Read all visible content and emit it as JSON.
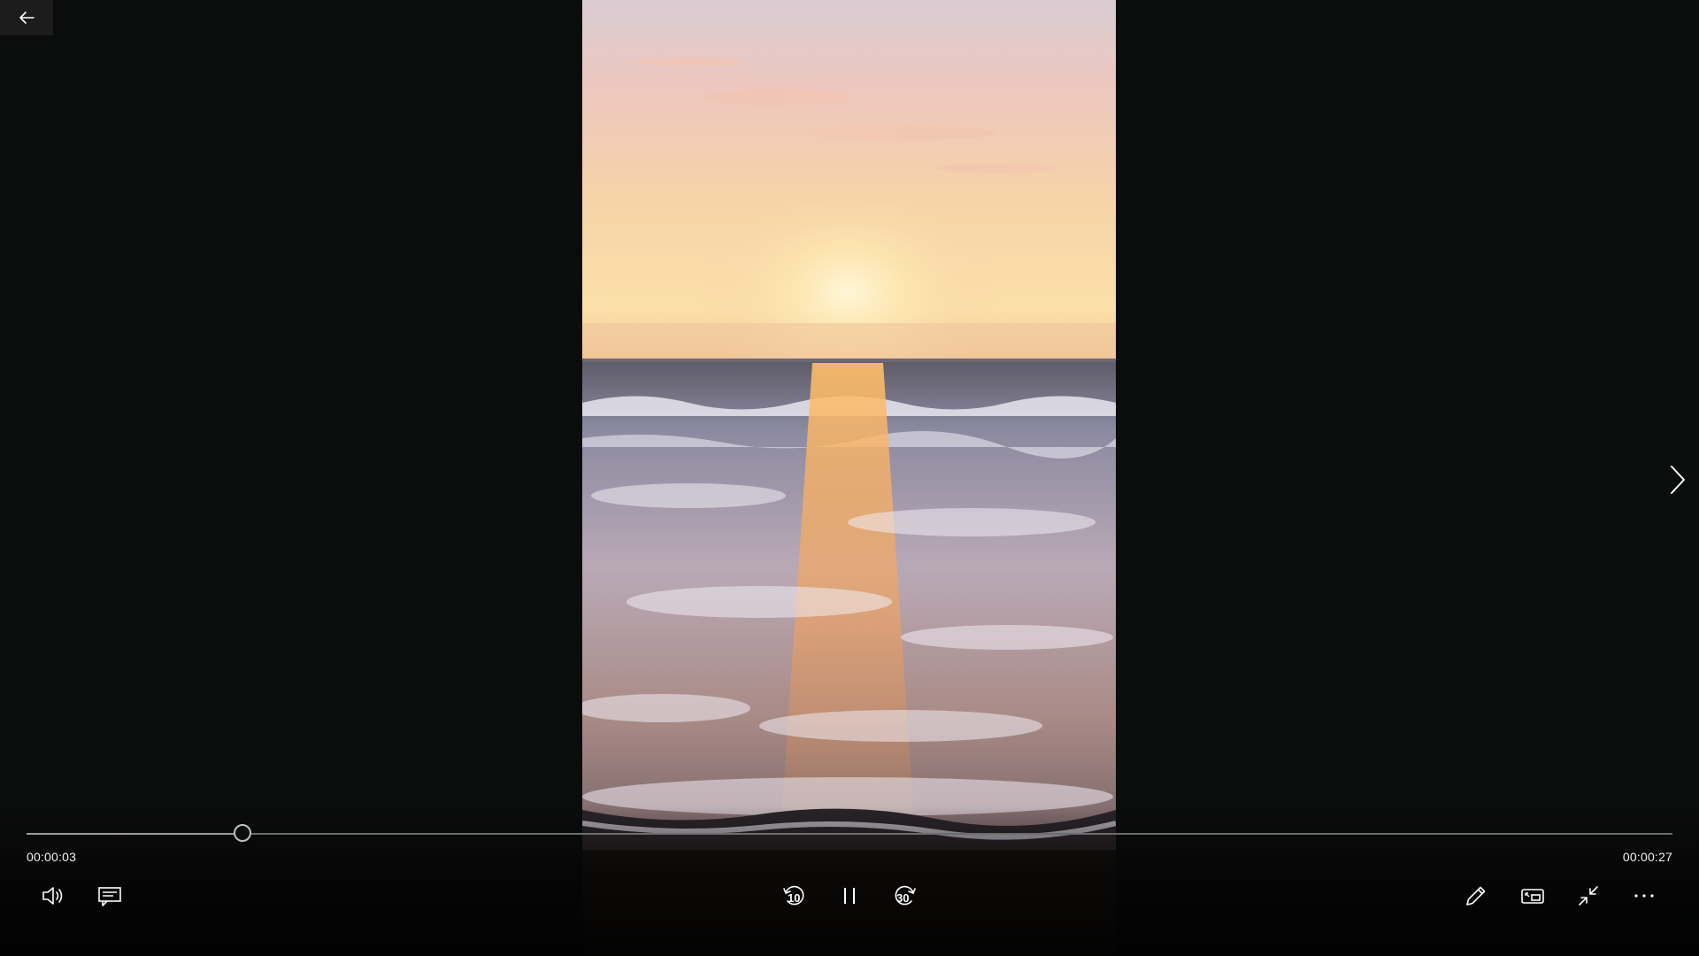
{
  "app": {
    "window": "Movies & TV player"
  },
  "nav": {
    "back_icon": "back-arrow-icon",
    "next_icon": "chevron-right-icon"
  },
  "playback": {
    "elapsed": "00:00:03",
    "total": "00:00:27",
    "progress_fraction": 0.1316,
    "state": "playing"
  },
  "controls": {
    "left": [
      {
        "icon": "volume-icon"
      },
      {
        "icon": "subtitles-icon"
      }
    ],
    "center": [
      {
        "icon": "skip-back-icon",
        "label": "10"
      },
      {
        "icon": "pause-icon"
      },
      {
        "icon": "skip-forward-icon",
        "label": "30"
      }
    ],
    "right": [
      {
        "icon": "edit-pencil-icon"
      },
      {
        "icon": "mini-view-icon"
      },
      {
        "icon": "exit-fullscreen-icon"
      },
      {
        "icon": "more-options-icon"
      }
    ]
  },
  "colors": {
    "background": "#0b0d0c",
    "control_fg": "#ffffff",
    "seek_track": "#6b6d6c"
  }
}
